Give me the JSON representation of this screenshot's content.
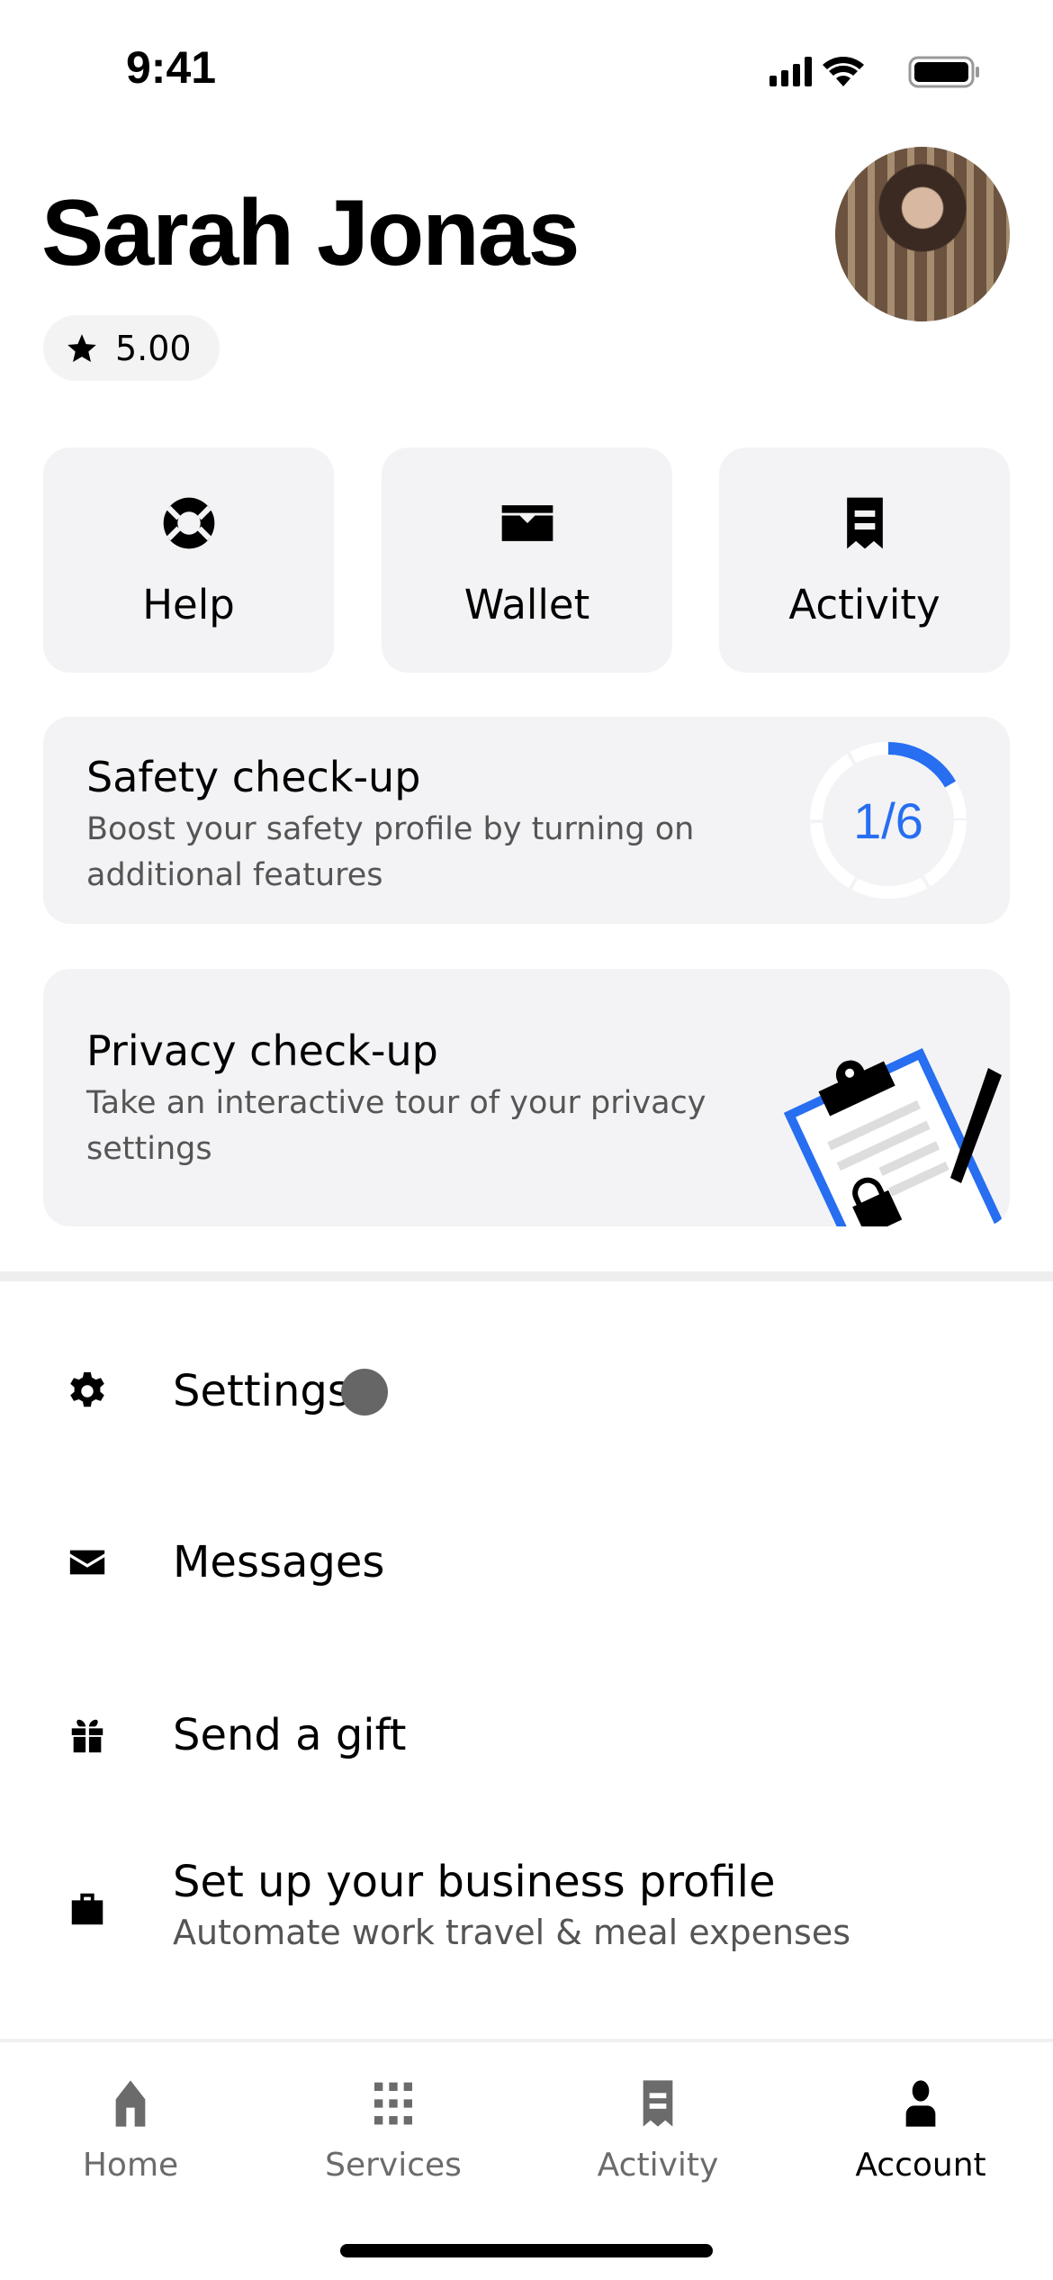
{
  "status_bar": {
    "time": "9:41"
  },
  "profile": {
    "name": "Sarah Jonas",
    "rating": "5.00"
  },
  "tiles": [
    {
      "label": "Help",
      "icon": "lifebuoy-icon"
    },
    {
      "label": "Wallet",
      "icon": "wallet-icon"
    },
    {
      "label": "Activity",
      "icon": "receipt-icon"
    }
  ],
  "safety": {
    "title": "Safety check-up",
    "subtitle": "Boost your safety profile by turning on additional features",
    "progress": "1/6",
    "progress_fraction": 0.1667,
    "accent": "#276ef1"
  },
  "privacy": {
    "title": "Privacy check-up",
    "subtitle": "Take an interactive tour of your privacy settings"
  },
  "menu": [
    {
      "label": "Settings",
      "icon": "gear-icon"
    },
    {
      "label": "Messages",
      "icon": "envelope-icon"
    },
    {
      "label": "Send a gift",
      "icon": "gift-icon"
    },
    {
      "label": "Set up your business profile",
      "sub": "Automate work travel & meal expenses",
      "icon": "briefcase-icon"
    }
  ],
  "nav": [
    {
      "label": "Home",
      "active": false
    },
    {
      "label": "Services",
      "active": false
    },
    {
      "label": "Activity",
      "active": false
    },
    {
      "label": "Account",
      "active": true
    }
  ]
}
